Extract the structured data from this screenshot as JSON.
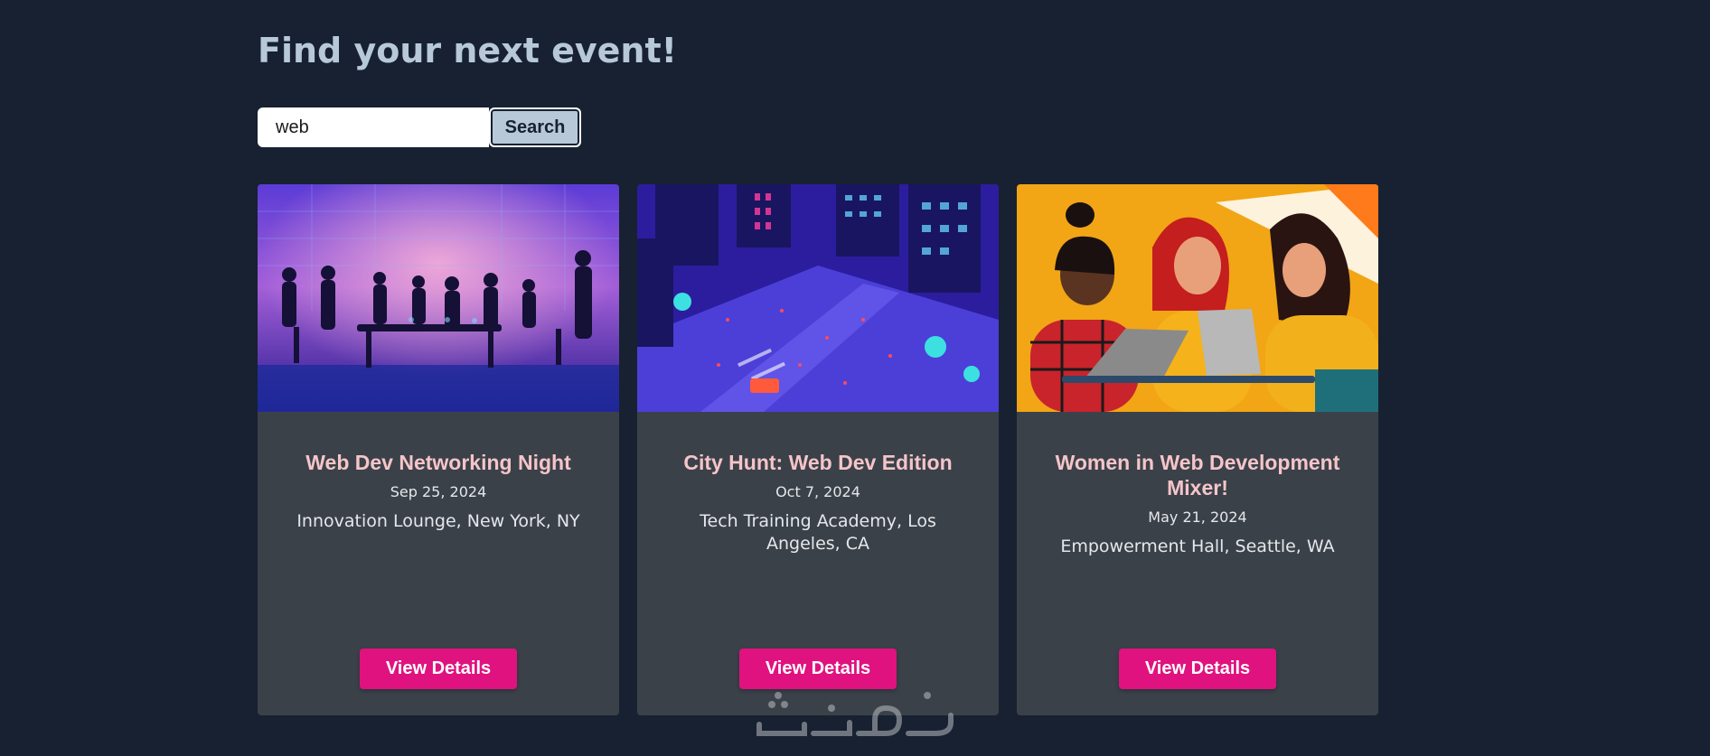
{
  "page": {
    "title": "Find your next event!"
  },
  "search": {
    "value": "web",
    "button_label": "Search"
  },
  "events": [
    {
      "title": "Web Dev Networking Night",
      "date": "Sep 25, 2024",
      "location": "Innovation Lounge, New York, NY",
      "button_label": "View Details",
      "image": "networking-night-illustration"
    },
    {
      "title": "City Hunt: Web Dev Edition",
      "date": "Oct 7, 2024",
      "location": "Tech Training Academy, Los Angeles, CA",
      "button_label": "View Details",
      "image": "city-hunt-illustration"
    },
    {
      "title": "Women in Web Development Mixer!",
      "date": "May 21, 2024",
      "location": "Empowerment Hall, Seattle, WA",
      "button_label": "View Details",
      "image": "women-in-web-dev-illustration"
    }
  ],
  "colors": {
    "background": "#172131",
    "title": "#b7c8d8",
    "card": "#3b4149",
    "card_title": "#f5c5c9",
    "accent": "#e0127f"
  }
}
